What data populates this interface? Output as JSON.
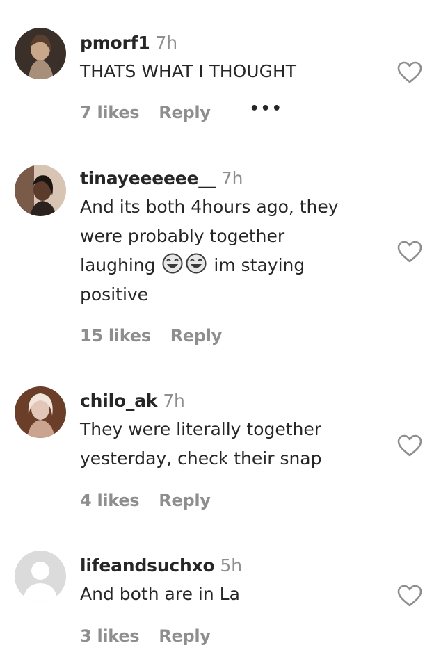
{
  "comments": [
    {
      "username": "pmorf1",
      "time": "7h",
      "text": "THATS WHAT I THOUGHT",
      "likes": "7 likes",
      "reply": "Reply",
      "more": "•••"
    },
    {
      "username": "tinayeeeeee__",
      "time": "7h",
      "text_part1": "And its both 4hours ago, they\nwere probably together\nlaughing",
      "emoji": "😂😂",
      "text_part2": "im staying\npositive",
      "likes": "15 likes",
      "reply": "Reply"
    },
    {
      "username": "chilo_ak",
      "time": "7h",
      "text": "They were literally together\nyesterday, check their snap",
      "likes": "4 likes",
      "reply": "Reply"
    },
    {
      "username": "lifeandsuchxo",
      "time": "5h",
      "text": "And both are in La",
      "likes": "3 likes",
      "reply": "Reply"
    }
  ],
  "colors": {
    "text": "#262626",
    "muted": "#8e8e8e",
    "background": "#ffffff"
  }
}
